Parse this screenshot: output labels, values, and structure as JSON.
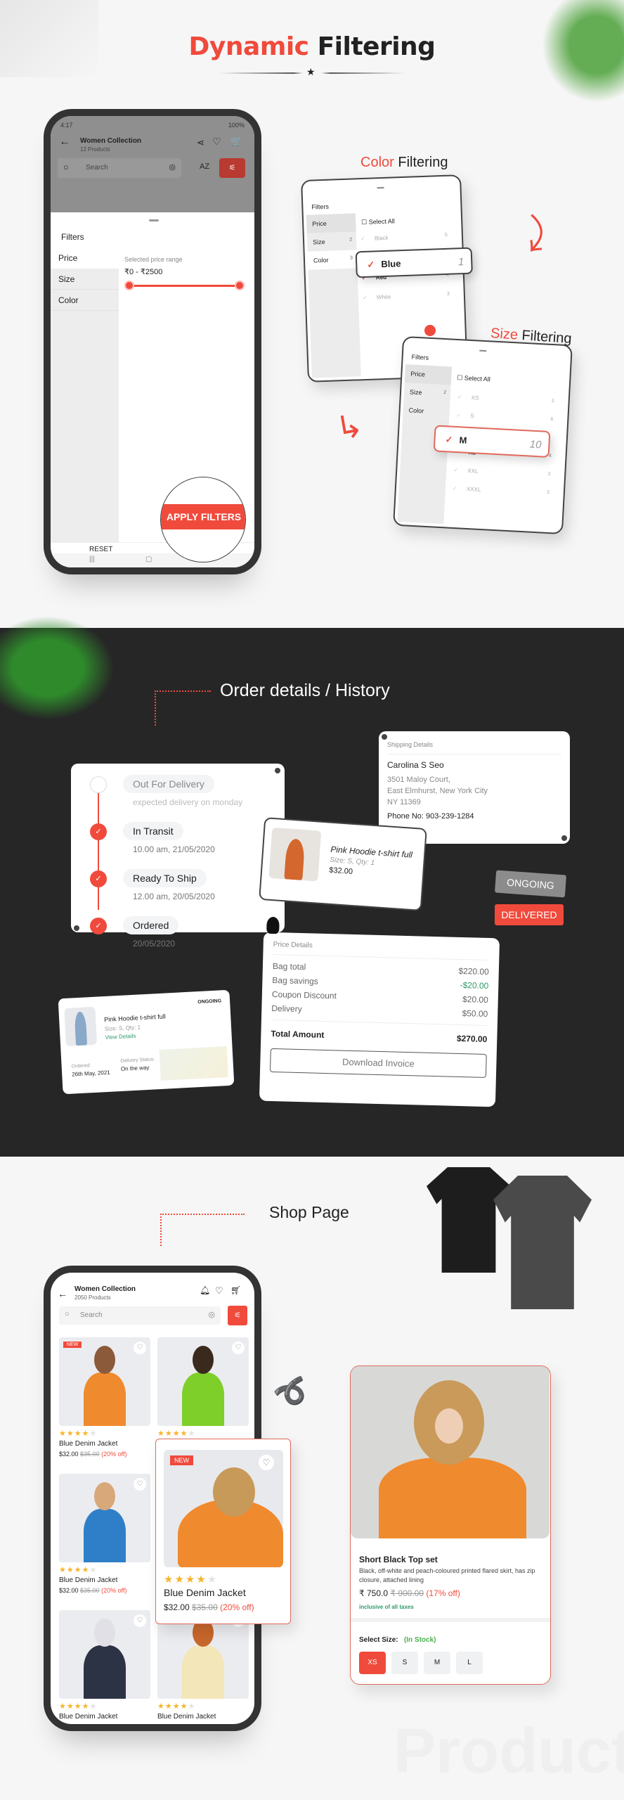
{
  "colors": {
    "accent": "#f04a3c",
    "dark": "#262626",
    "green": "#2e9a6a"
  },
  "header": {
    "title_accent": "Dynamic",
    "title_rest": "Filtering"
  },
  "filter_phone": {
    "status_time": "4:17",
    "status_battery": "100%",
    "title": "Women Collection",
    "subtitle": "12 Products",
    "search_placeholder": "Search",
    "sort_label": "AZ",
    "sheet_title": "Filters",
    "categories": [
      "Price",
      "Size",
      "Color"
    ],
    "price_label": "Selected price range",
    "price_range": "₹0 - ₹2500",
    "price_min": 0,
    "price_max": 2500,
    "reset": "RESET",
    "apply": "APPLY FILTERS"
  },
  "color_filter": {
    "label_accent": "Color",
    "label_rest": "Filtering",
    "sheet_title": "Filters",
    "categories": [
      {
        "name": "Price",
        "count": ""
      },
      {
        "name": "Size",
        "count": "2"
      },
      {
        "name": "Color",
        "count": "3"
      }
    ],
    "select_all": "Select All",
    "options": [
      {
        "name": "Black",
        "count": "5",
        "checked": false
      },
      {
        "name": "Blue",
        "count": "1",
        "checked": true
      },
      {
        "name": "Red",
        "count": "2",
        "checked": true
      },
      {
        "name": "White",
        "count": "3",
        "checked": false
      }
    ]
  },
  "size_filter": {
    "label_accent": "Size",
    "label_rest": "Filtering",
    "sheet_title": "Filters",
    "categories": [
      {
        "name": "Price",
        "count": ""
      },
      {
        "name": "Size",
        "count": "2"
      },
      {
        "name": "Color",
        "count": ""
      }
    ],
    "select_all": "Select All",
    "options": [
      {
        "name": "XS",
        "count": "3",
        "checked": false
      },
      {
        "name": "S",
        "count": "6",
        "checked": false
      },
      {
        "name": "M",
        "count": "10",
        "checked": true
      },
      {
        "name": "XL",
        "count": "4",
        "checked": true
      },
      {
        "name": "XXL",
        "count": "3",
        "checked": false
      },
      {
        "name": "XXXL",
        "count": "3",
        "checked": false
      }
    ]
  },
  "orders": {
    "title": "Order details / History",
    "timeline": [
      {
        "status": "Out For Delivery",
        "detail": "expected delivery on monday",
        "done": false
      },
      {
        "status": "In Transit",
        "detail": "10.00 am, 21/05/2020",
        "done": true
      },
      {
        "status": "Ready To Ship",
        "detail": "12.00 am, 20/05/2020",
        "done": true
      },
      {
        "status": "Ordered",
        "detail": "20/05/2020",
        "done": true
      }
    ],
    "shipping": {
      "title": "Shipping Details",
      "name": "Carolina S Seo",
      "line1": "3501  Maloy Court,",
      "line2": "East Elmhurst, New York City",
      "line3": "NY 11369",
      "phone": "Phone No: 903-239-1284"
    },
    "item": {
      "name": "Pink Hoodie t-shirt full",
      "meta": "Size: S, Qty: 1",
      "price": "$32.00"
    },
    "badges": {
      "ongoing": "ONGOING",
      "delivered": "DELIVERED"
    },
    "order_card": {
      "status": "ONGOING",
      "name": "Pink Hoodie t-shirt full",
      "meta": "Size: S, Qty: 1",
      "link": "View Details",
      "ordered_label": "Ordered:",
      "ordered_date": "26th May, 2021",
      "delivery_label": "Delivery Status:",
      "delivery_value": "On the way"
    },
    "price": {
      "title": "Price Details",
      "rows": [
        {
          "label": "Bag total",
          "value": "$220.00"
        },
        {
          "label": "Bag savings",
          "value": "-$20.00"
        },
        {
          "label": "Coupon Discount",
          "value": "$20.00"
        },
        {
          "label": "Delivery",
          "value": "$50.00"
        }
      ],
      "total_label": "Total Amount",
      "total_value": "$270.00",
      "button": "Download Invoice"
    }
  },
  "shop": {
    "title": "Shop Page",
    "phone": {
      "title": "Women Collection",
      "subtitle": "2050 Products",
      "search_placeholder": "Search",
      "products": [
        {
          "name": "Blue Denim Jacket",
          "price": "$32.00",
          "old": "$35.00",
          "off": "(20% off)",
          "rating": 4,
          "new": "NEW"
        },
        {
          "name": "Blue Denim Jacket",
          "price": "$32.00",
          "old": "$35.00",
          "off": "(20% off)",
          "rating": 4,
          "new": ""
        },
        {
          "name": "Blue Denim Jacket",
          "price": "$32.00",
          "old": "$35.00",
          "off": "(20% off)",
          "rating": 4,
          "new": ""
        },
        {
          "name": "Blue Denim Jacket",
          "price": "$32.00",
          "old": "$35.00",
          "off": "(20% off)",
          "rating": 4,
          "new": ""
        },
        {
          "name": "Blue Denim Jacket",
          "price": "",
          "old": "",
          "off": "",
          "rating": 4,
          "new": ""
        },
        {
          "name": "Blue Denim Jacket",
          "price": "",
          "old": "",
          "off": "",
          "rating": 4,
          "new": ""
        }
      ]
    },
    "popup": {
      "new": "NEW",
      "name": "Blue Denim Jacket",
      "price": "$32.00",
      "old": "$35.00",
      "off": "(20% off)",
      "rating": 4
    },
    "detail": {
      "name": "Short Black Top set",
      "desc": "Black, off-white and peach-coloured printed flared skirt, has zip closure, attached lining",
      "price": "₹ 750.0",
      "old": "₹ 900.00",
      "off": "(17% off)",
      "tax": "inclusive of all taxes",
      "size_label": "Select Size:",
      "stock": "(In Stock)",
      "sizes": [
        "XS",
        "S",
        "M",
        "L"
      ],
      "selected": "XS"
    },
    "watermark": "Product"
  }
}
